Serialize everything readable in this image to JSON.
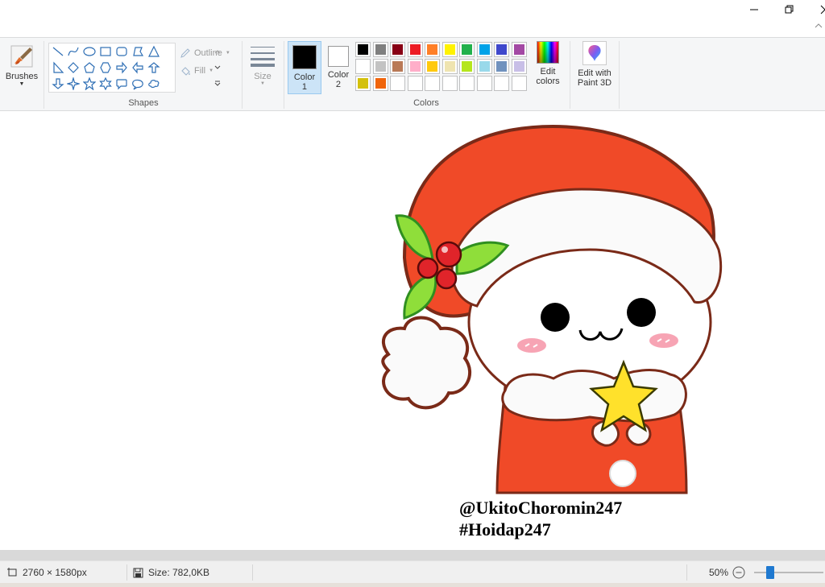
{
  "window": {
    "minimize_label": "—",
    "restore_label": "❐",
    "close_label": "✕"
  },
  "ribbon": {
    "brushes_label": "Brushes",
    "shapes_group_label": "Shapes",
    "outline_label": "Outline",
    "fill_label": "Fill",
    "size_label": "Size",
    "colors_group_label": "Colors",
    "color1_label": "Color\n1",
    "color1_line1": "Color",
    "color1_line2": "1",
    "color2_line1": "Color",
    "color2_line2": "2",
    "edit_colors_line1": "Edit",
    "edit_colors_line2": "colors",
    "paint3d_line1": "Edit with",
    "paint3d_line2": "Paint 3D",
    "color1_value": "#000000",
    "color2_value": "#ffffff",
    "palette": [
      [
        "#000000",
        "#7f7f7f",
        "#880015",
        "#ed1c24",
        "#ff7f27",
        "#fff200",
        "#22b14c",
        "#00a2e8",
        "#3f48cc",
        "#a349a4"
      ],
      [
        "#ffffff",
        "#c3c3c3",
        "#b97a57",
        "#ffaec9",
        "#ffc90e",
        "#efe4b0",
        "#b5e61d",
        "#99d9ea",
        "#7092be",
        "#c8bfe7"
      ],
      [
        "#d4c10b",
        "#f0640a",
        "",
        "",
        "",
        "",
        "",
        "",
        "",
        ""
      ]
    ],
    "shape_icons": [
      "line-icon",
      "curve-icon",
      "oval-icon",
      "rectangle-icon",
      "rounded-rectangle-icon",
      "polygon-icon",
      "triangle-icon",
      "right-triangle-icon",
      "diamond-icon",
      "pentagon-icon",
      "hexagon-icon",
      "right-arrow-icon",
      "left-arrow-icon",
      "up-arrow-icon",
      "down-arrow-icon",
      "four-point-star-icon",
      "five-point-star-icon",
      "six-point-star-icon",
      "rounded-callout-icon",
      "oval-callout-icon",
      "cloud-callout-icon"
    ]
  },
  "canvas": {
    "credit_line1": "@UkitoChoromin247",
    "credit_line2": "#Hoidap247"
  },
  "status": {
    "dimensions": "2760 × 1580px",
    "size": "Size: 782,0KB",
    "zoom": "50%"
  }
}
